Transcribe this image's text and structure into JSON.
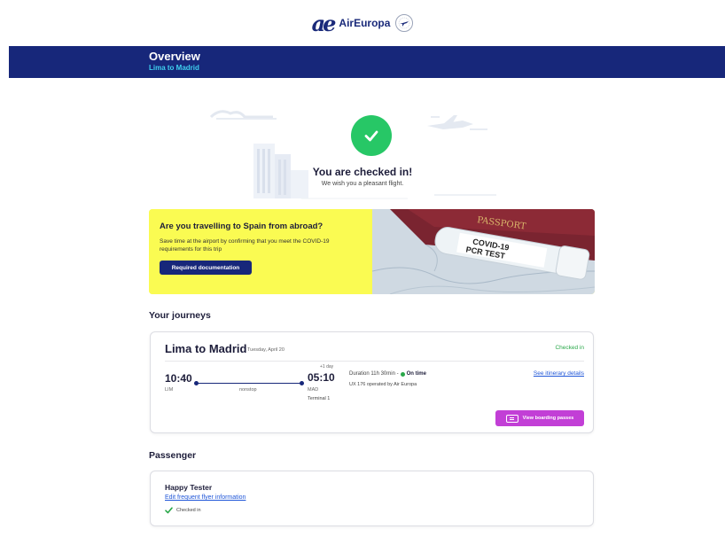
{
  "brand": {
    "logo_mark": "ae",
    "name": "AirEuropa"
  },
  "header": {
    "title": "Overview",
    "subtitle": "Lima to Madrid",
    "background_color": "#17277a",
    "subtitle_color": "#3fd0f0"
  },
  "confirmation": {
    "title": "You are checked in!",
    "subtitle": "We wish you a pleasant flight.",
    "icon": "check-circle-icon",
    "color": "#27c766"
  },
  "covid_banner": {
    "title": "Are you travelling to Spain from abroad?",
    "text": "Save time at the airport by confirming that you meet the COVID-19 requirements for this trip",
    "button_label": "Required documentation",
    "photo_label_line1": "COVID-19",
    "photo_label_line2": "PCR TEST",
    "photo_passport_text": "PASSPORT",
    "background_color": "#fafb52"
  },
  "journeys": {
    "section_title": "Your journeys",
    "items": [
      {
        "route": "Lima to Madrid",
        "date": "Tuesday, April 20",
        "status": "Checked in",
        "departure_time": "10:40",
        "departure_code": "LIM",
        "stops": "nonstop",
        "day_offset": "+1 day",
        "arrival_time": "05:10",
        "arrival_code": "MAD",
        "terminal": "Terminal 1",
        "duration": "Duration 11h 30min -",
        "on_time": "On time",
        "operated_by": "UX 176 operated by Air Europa",
        "itinerary_link": "See itinerary details",
        "boarding_pass_button": "View boarding passes"
      }
    ]
  },
  "passengers": {
    "section_title": "Passenger",
    "items": [
      {
        "name": "Happy Tester",
        "ff_link": "Edit frequent flyer information",
        "status": "Checked in"
      }
    ]
  },
  "colors": {
    "navy": "#17277a",
    "success": "#2aa84a",
    "link": "#1f56d8",
    "boarding_button": "#c23fd6"
  }
}
